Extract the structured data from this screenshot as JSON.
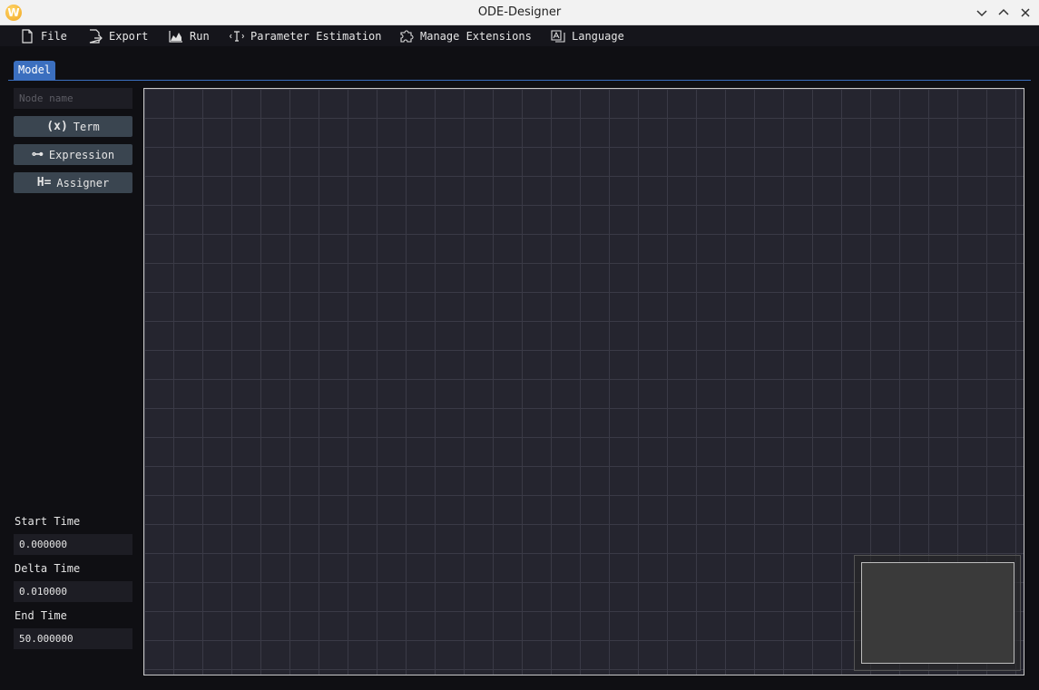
{
  "window": {
    "title": "ODE-Designer",
    "app_icon_letter": "W"
  },
  "menu": {
    "items": [
      {
        "label": "File",
        "icon": "file-icon"
      },
      {
        "label": "Export",
        "icon": "export-icon"
      },
      {
        "label": "Run",
        "icon": "chart-icon"
      },
      {
        "label": "Parameter Estimation",
        "icon": "text-cursor-icon"
      },
      {
        "label": "Manage Extensions",
        "icon": "puzzle-icon"
      },
      {
        "label": "Language",
        "icon": "language-icon"
      }
    ]
  },
  "tabs": [
    {
      "label": "Model",
      "active": true
    }
  ],
  "sidebar": {
    "node_name_placeholder": "Node name",
    "buttons": [
      {
        "label": "Term",
        "icon_text": "(x)"
      },
      {
        "label": "Expression",
        "icon_text": "⊶"
      },
      {
        "label": "Assigner",
        "icon_text": "H="
      }
    ],
    "fields": [
      {
        "label": "Start Time",
        "value": "0.000000"
      },
      {
        "label": "Delta Time",
        "value": "0.010000"
      },
      {
        "label": "End Time",
        "value": "50.000000"
      }
    ]
  },
  "colors": {
    "accent": "#3b6fbf",
    "canvas_bg": "#25252f",
    "button_bg": "#3a4550"
  }
}
